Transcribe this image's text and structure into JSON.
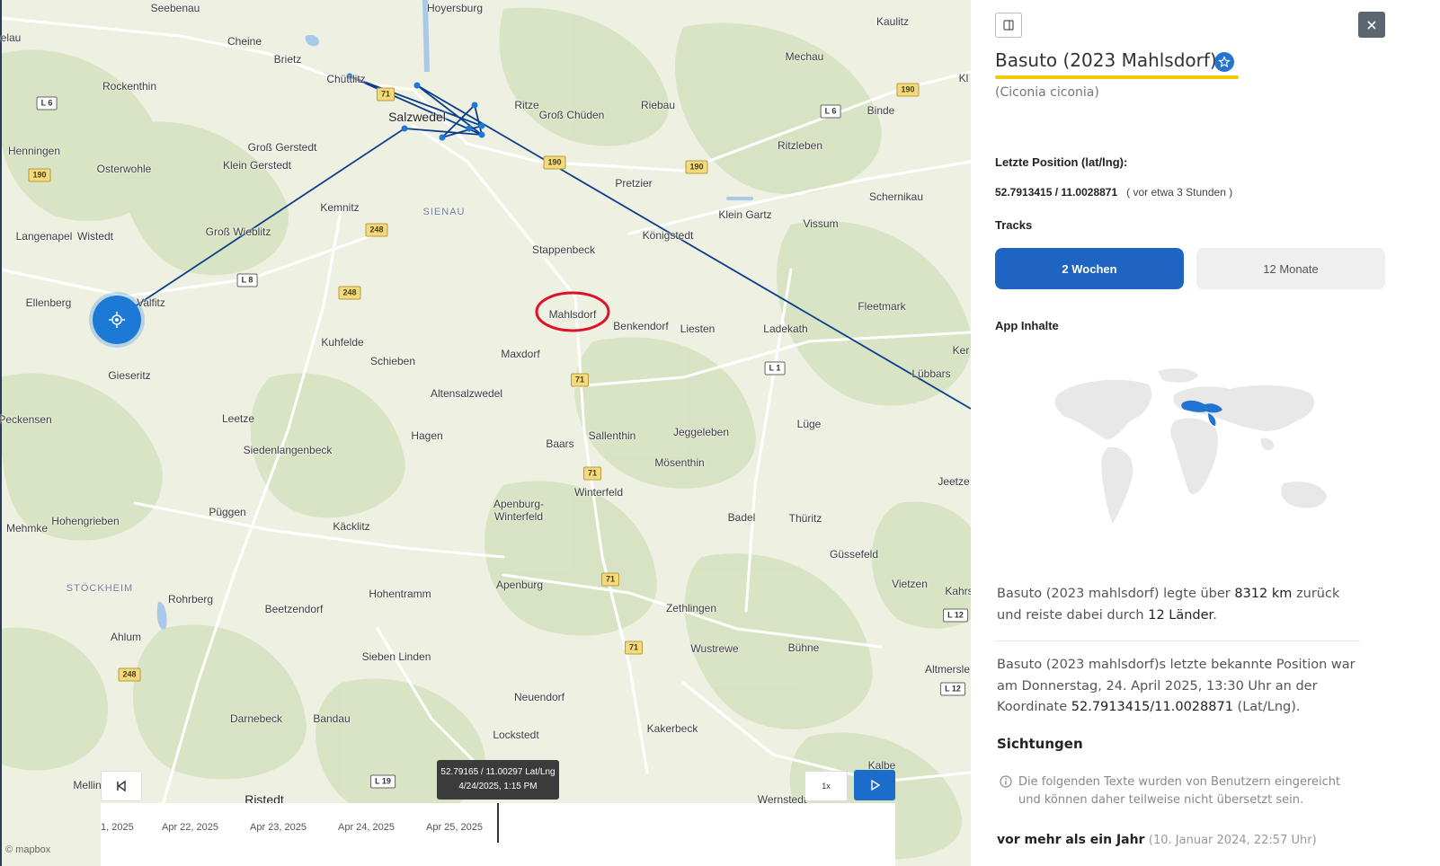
{
  "map": {
    "places": [
      {
        "name": "Seebenau"
      },
      {
        "name": "Hoyersburg"
      },
      {
        "name": "Kaulitz"
      },
      {
        "name": "elau"
      },
      {
        "name": "Cheine"
      },
      {
        "name": "Brietz"
      },
      {
        "name": "Chüttlitz"
      },
      {
        "name": "Mechau"
      },
      {
        "name": "Rockenthin"
      },
      {
        "name": "Salzwedel"
      },
      {
        "name": "Ritze"
      },
      {
        "name": "Groß Chüden"
      },
      {
        "name": "Riebau"
      },
      {
        "name": "Binde"
      },
      {
        "name": "Henningen"
      },
      {
        "name": "Groß Gerstedt"
      },
      {
        "name": "Ritzleben"
      },
      {
        "name": "Osterwohle"
      },
      {
        "name": "Klein Gerstedt"
      },
      {
        "name": "Pretzier"
      },
      {
        "name": "Schernikau"
      },
      {
        "name": "Kemnitz"
      },
      {
        "name": "SIENAU"
      },
      {
        "name": "Klein Gartz"
      },
      {
        "name": "Vissum"
      },
      {
        "name": "Langenapel"
      },
      {
        "name": "Wistedt"
      },
      {
        "name": "Groß Wieblitz"
      },
      {
        "name": "Stappenbeck"
      },
      {
        "name": "Königstedt"
      },
      {
        "name": "Ellenberg"
      },
      {
        "name": "Valfitz"
      },
      {
        "name": "Mahlsdorf"
      },
      {
        "name": "Fleetmark"
      },
      {
        "name": "Benkendorf"
      },
      {
        "name": "Liesten"
      },
      {
        "name": "Ladekath"
      },
      {
        "name": "Kuhfelde"
      },
      {
        "name": "Maxdorf"
      },
      {
        "name": "Schieben"
      },
      {
        "name": "Gieseritz"
      },
      {
        "name": "Lübbars"
      },
      {
        "name": "Altensalzwedel"
      },
      {
        "name": "Ker"
      },
      {
        "name": "Peckensen"
      },
      {
        "name": "Leetze"
      },
      {
        "name": "Lüge"
      },
      {
        "name": "Hagen"
      },
      {
        "name": "Sallenthin"
      },
      {
        "name": "Jeggeleben"
      },
      {
        "name": "Siedenlangenbeck"
      },
      {
        "name": "Baars"
      },
      {
        "name": "Mösenthin"
      },
      {
        "name": "Jeetze"
      },
      {
        "name": "Winterfeld"
      },
      {
        "name": "Apenburg-"
      },
      {
        "name": "Winterfeld"
      },
      {
        "name": "Püggen"
      },
      {
        "name": "Badel"
      },
      {
        "name": "Thüritz"
      },
      {
        "name": "Mehmke"
      },
      {
        "name": "Hohengrieben"
      },
      {
        "name": "Käcklitz"
      },
      {
        "name": "Güssefeld"
      },
      {
        "name": "Vietzen"
      },
      {
        "name": "Apenburg"
      },
      {
        "name": "STÖCKHEIM"
      },
      {
        "name": "Hohentramm"
      },
      {
        "name": "Kahrs"
      },
      {
        "name": "Rohrberg"
      },
      {
        "name": "Zethlingen"
      },
      {
        "name": "Beetzendorf"
      },
      {
        "name": "Ahlum"
      },
      {
        "name": "Wustrewe"
      },
      {
        "name": "Bühne"
      },
      {
        "name": "Altmersle"
      },
      {
        "name": "Sieben Linden"
      },
      {
        "name": "Neuendorf"
      },
      {
        "name": "Darnebeck"
      },
      {
        "name": "Bandau"
      },
      {
        "name": "Kakerbeck"
      },
      {
        "name": "Lockstedt"
      },
      {
        "name": "Kalbe"
      },
      {
        "name": "Mellin"
      },
      {
        "name": "Ristedt"
      },
      {
        "name": "Wernstedt"
      },
      {
        "name": "Kl"
      }
    ],
    "shields": [
      {
        "text": "L 6",
        "type": "l"
      },
      {
        "text": "71",
        "type": "b"
      },
      {
        "text": "190",
        "type": "b"
      },
      {
        "text": "190",
        "type": "b"
      },
      {
        "text": "L 6",
        "type": "l"
      },
      {
        "text": "190",
        "type": "b"
      },
      {
        "text": "190",
        "type": "b"
      },
      {
        "text": "248",
        "type": "b"
      },
      {
        "text": "L 8",
        "type": "l"
      },
      {
        "text": "248",
        "type": "b"
      },
      {
        "text": "L 1",
        "type": "l"
      },
      {
        "text": "71",
        "type": "b"
      },
      {
        "text": "71",
        "type": "b"
      },
      {
        "text": "71",
        "type": "b"
      },
      {
        "text": "L 12",
        "type": "l"
      },
      {
        "text": "71",
        "type": "b"
      },
      {
        "text": "248",
        "type": "b"
      },
      {
        "text": "L 12",
        "type": "l"
      },
      {
        "text": "L 19",
        "type": "l"
      }
    ],
    "tooltip": {
      "line1": "52.79165 / 11.00297 Lat/Lng",
      "line2": "4/24/2025, 1:15 PM"
    },
    "timeline_labels": [
      "1, 2025",
      "Apr 22, 2025",
      "Apr 23, 2025",
      "Apr 24, 2025",
      "Apr 25, 2025"
    ],
    "speed_label": "1x",
    "attribution": "© mapbox"
  },
  "panel": {
    "title": "Basuto (2023 Mahlsdorf)",
    "subtitle": "(Ciconia ciconia)",
    "last_position_label": "Letzte Position (lat/lng):",
    "last_position_value": "52.7913415 / 11.0028871",
    "last_position_ago": "( vor etwa 3 Stunden )",
    "tracks_label": "Tracks",
    "tabs": [
      {
        "label": "2 Wochen"
      },
      {
        "label": "12 Monate"
      }
    ],
    "app_content_label": "App Inhalte",
    "para1_a": "Basuto (2023 mahlsdorf) legte über ",
    "para1_km": "8312 km",
    "para1_b": " zurück und reiste dabei durch ",
    "para1_countries": "12 Länder",
    "para1_c": ".",
    "para2_a": "Basuto (2023 mahlsdorf)s letzte bekannte Position war am Donnerstag, 24. April 2025, 13:30 Uhr an der Koordinate ",
    "para2_coord": "52.7913415/11.0028871",
    "para2_b": " (Lat/Lng).",
    "sightings_label": "Sichtungen",
    "info_text": "Die folgenden Texte wurden von Benutzern eingereicht und können daher teilweise nicht übersetzt sein.",
    "entry_time": "vor mehr als ein Jahr",
    "entry_date": "(10. Januar 2024, 22:57 Uhr)"
  },
  "colors": {
    "track": "#0a3f8c",
    "accent": "#1f64c1",
    "highlight": "#f5c800",
    "annotation": "#e0102a"
  }
}
